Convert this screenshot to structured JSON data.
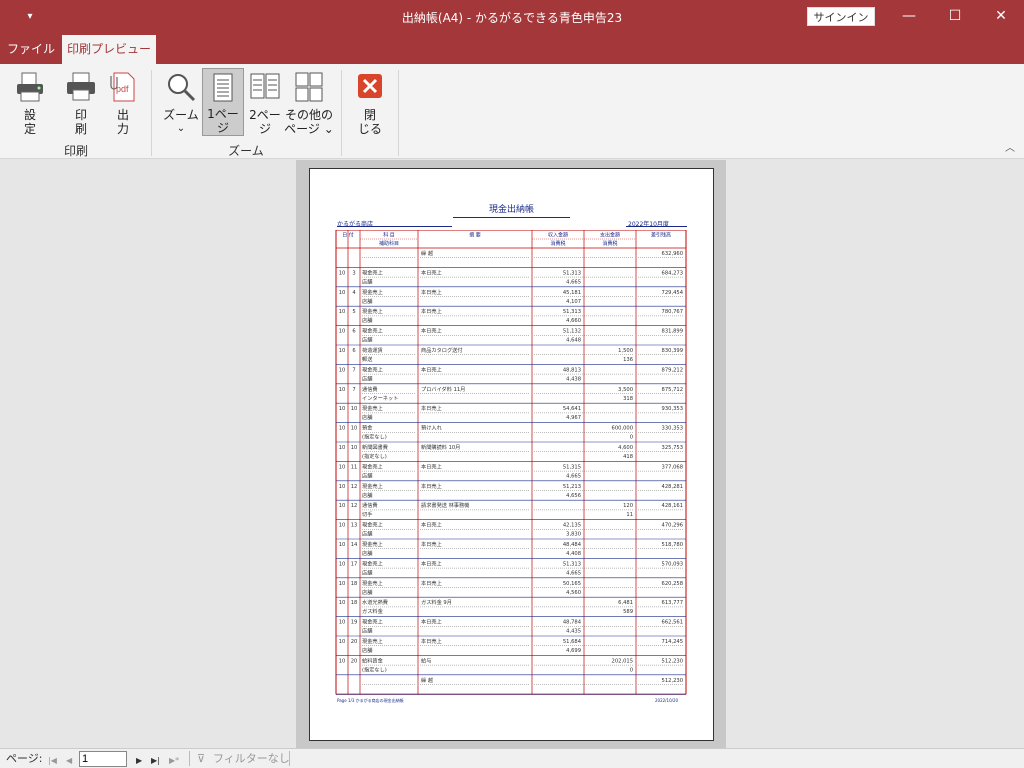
{
  "window": {
    "title": "出納帳(A4)  -  かるがるできる青色申告23",
    "sign_in": "サインイン",
    "minimize": "—",
    "maximize": "☐",
    "close": "✕"
  },
  "tabs": [
    {
      "label": "ファイル"
    },
    {
      "label": "印刷プレビュー"
    }
  ],
  "ribbon": {
    "settings": {
      "line1": "設",
      "line2": "定"
    },
    "print": {
      "line1": "印",
      "line2": "刷"
    },
    "output": {
      "line1": "出",
      "line2": "力"
    },
    "group_print": "印刷",
    "zoom": {
      "line1": "ズーム",
      "line2": "⌄"
    },
    "one_page": {
      "line1": "1ペー",
      "line2": "ジ"
    },
    "two_page": {
      "line1": "2ペー",
      "line2": "ジ"
    },
    "other_pages": {
      "line1": "その他の",
      "line2": "ページ ⌄"
    },
    "group_zoom": "ズーム",
    "close_preview": {
      "line1": "閉",
      "line2": "じる"
    },
    "collapse": "︿"
  },
  "report": {
    "title": "現金出納帳",
    "company": "かるがる商店",
    "period": "2022年10月度",
    "headers": {
      "date": "日 付",
      "account": "科 目",
      "sub_account": "補助科目",
      "description": "摘   要",
      "income": "収入金額",
      "income_sub": "消費税",
      "expense": "支出金額",
      "expense_sub": "消費税",
      "balance": "差引残高"
    },
    "rows": [
      {
        "m": "",
        "d": "",
        "a": "",
        "sa": "",
        "desc": "繰 越",
        "inc": "",
        "inc_tax": "",
        "exp": "",
        "exp_tax": "",
        "bal": "632,960"
      },
      {
        "m": "10",
        "d": "3",
        "a": "現金売上",
        "sa": "店舗",
        "desc": "本日売上",
        "inc": "51,313",
        "inc_tax": "4,665",
        "exp": "",
        "exp_tax": "",
        "bal": "684,273"
      },
      {
        "m": "10",
        "d": "4",
        "a": "現金売上",
        "sa": "店舗",
        "desc": "本日売上",
        "inc": "45,181",
        "inc_tax": "4,107",
        "exp": "",
        "exp_tax": "",
        "bal": "729,454"
      },
      {
        "m": "10",
        "d": "5",
        "a": "現金売上",
        "sa": "店舗",
        "desc": "本日売上",
        "inc": "51,313",
        "inc_tax": "4,660",
        "exp": "",
        "exp_tax": "",
        "bal": "780,767"
      },
      {
        "m": "10",
        "d": "6",
        "a": "現金売上",
        "sa": "店舗",
        "desc": "本日売上",
        "inc": "51,132",
        "inc_tax": "4,648",
        "exp": "",
        "exp_tax": "",
        "bal": "831,899"
      },
      {
        "m": "10",
        "d": "6",
        "a": "荷造運賃",
        "sa": "郵送",
        "desc": "商品カタログ送付",
        "inc": "",
        "inc_tax": "",
        "exp": "1,500",
        "exp_tax": "136",
        "bal": "830,399"
      },
      {
        "m": "10",
        "d": "7",
        "a": "現金売上",
        "sa": "店舗",
        "desc": "本日売上",
        "inc": "48,813",
        "inc_tax": "4,438",
        "exp": "",
        "exp_tax": "",
        "bal": "879,212"
      },
      {
        "m": "10",
        "d": "7",
        "a": "通信費",
        "sa": "インターネット",
        "desc": "プロバイダ料 11月",
        "inc": "",
        "inc_tax": "",
        "exp": "3,500",
        "exp_tax": "318",
        "bal": "875,712"
      },
      {
        "m": "10",
        "d": "10",
        "a": "現金売上",
        "sa": "店舗",
        "desc": "本日売上",
        "inc": "54,641",
        "inc_tax": "4,967",
        "exp": "",
        "exp_tax": "",
        "bal": "930,353"
      },
      {
        "m": "10",
        "d": "10",
        "a": "預金",
        "sa": "(指定なし)",
        "desc": "預け入れ",
        "inc": "",
        "inc_tax": "",
        "exp": "600,000",
        "exp_tax": "0",
        "bal": "330,353"
      },
      {
        "m": "10",
        "d": "10",
        "a": "新聞図書費",
        "sa": "(指定なし)",
        "desc": "新聞購読料 10月",
        "inc": "",
        "inc_tax": "",
        "exp": "4,600",
        "exp_tax": "418",
        "bal": "325,753"
      },
      {
        "m": "10",
        "d": "11",
        "a": "現金売上",
        "sa": "店舗",
        "desc": "本日売上",
        "inc": "51,315",
        "inc_tax": "4,665",
        "exp": "",
        "exp_tax": "",
        "bal": "377,068"
      },
      {
        "m": "10",
        "d": "12",
        "a": "現金売上",
        "sa": "店舗",
        "desc": "本日売上",
        "inc": "51,213",
        "inc_tax": "4,656",
        "exp": "",
        "exp_tax": "",
        "bal": "428,281"
      },
      {
        "m": "10",
        "d": "12",
        "a": "通信費",
        "sa": "切手",
        "desc": "請求書発送 林事務機",
        "inc": "",
        "inc_tax": "",
        "exp": "120",
        "exp_tax": "11",
        "bal": "428,161"
      },
      {
        "m": "10",
        "d": "13",
        "a": "現金売上",
        "sa": "店舗",
        "desc": "本日売上",
        "inc": "42,135",
        "inc_tax": "3,830",
        "exp": "",
        "exp_tax": "",
        "bal": "470,296"
      },
      {
        "m": "10",
        "d": "14",
        "a": "現金売上",
        "sa": "店舗",
        "desc": "本日売上",
        "inc": "48,484",
        "inc_tax": "4,408",
        "exp": "",
        "exp_tax": "",
        "bal": "518,780"
      },
      {
        "m": "10",
        "d": "17",
        "a": "現金売上",
        "sa": "店舗",
        "desc": "本日売上",
        "inc": "51,313",
        "inc_tax": "4,665",
        "exp": "",
        "exp_tax": "",
        "bal": "570,093"
      },
      {
        "m": "10",
        "d": "18",
        "a": "現金売上",
        "sa": "店舗",
        "desc": "本日売上",
        "inc": "50,165",
        "inc_tax": "4,560",
        "exp": "",
        "exp_tax": "",
        "bal": "620,258"
      },
      {
        "m": "10",
        "d": "18",
        "a": "水道光熱費",
        "sa": "ガス料金",
        "desc": "ガス料金 9月",
        "inc": "",
        "inc_tax": "",
        "exp": "6,481",
        "exp_tax": "589",
        "bal": "613,777"
      },
      {
        "m": "10",
        "d": "19",
        "a": "現金売上",
        "sa": "店舗",
        "desc": "本日売上",
        "inc": "48,784",
        "inc_tax": "4,435",
        "exp": "",
        "exp_tax": "",
        "bal": "662,561"
      },
      {
        "m": "10",
        "d": "20",
        "a": "現金売上",
        "sa": "店舗",
        "desc": "本日売上",
        "inc": "51,684",
        "inc_tax": "4,699",
        "exp": "",
        "exp_tax": "",
        "bal": "714,245"
      },
      {
        "m": "10",
        "d": "20",
        "a": "給料賃金",
        "sa": "(指定なし)",
        "desc": "給与",
        "inc": "",
        "inc_tax": "",
        "exp": "202,015",
        "exp_tax": "0",
        "bal": "512,230"
      },
      {
        "m": "",
        "d": "",
        "a": "",
        "sa": "",
        "desc": "繰 越",
        "inc": "",
        "inc_tax": "",
        "exp": "",
        "exp_tax": "",
        "bal": "512,230"
      }
    ],
    "footer_left": "Page 1/3   かるがる商店の現金出納帳",
    "footer_right": "2022/10/20"
  },
  "status": {
    "page_label": "ページ:",
    "first": "|◀",
    "prev": "◀",
    "page_value": "1",
    "next": "▶",
    "last": "▶|",
    "new": "▶*",
    "filter_icon": "⊽",
    "filter": "フィルターなし"
  },
  "colors": {
    "accent": "#a4373a",
    "report_red": "#c00000",
    "report_blue": "#1a2a8a"
  }
}
